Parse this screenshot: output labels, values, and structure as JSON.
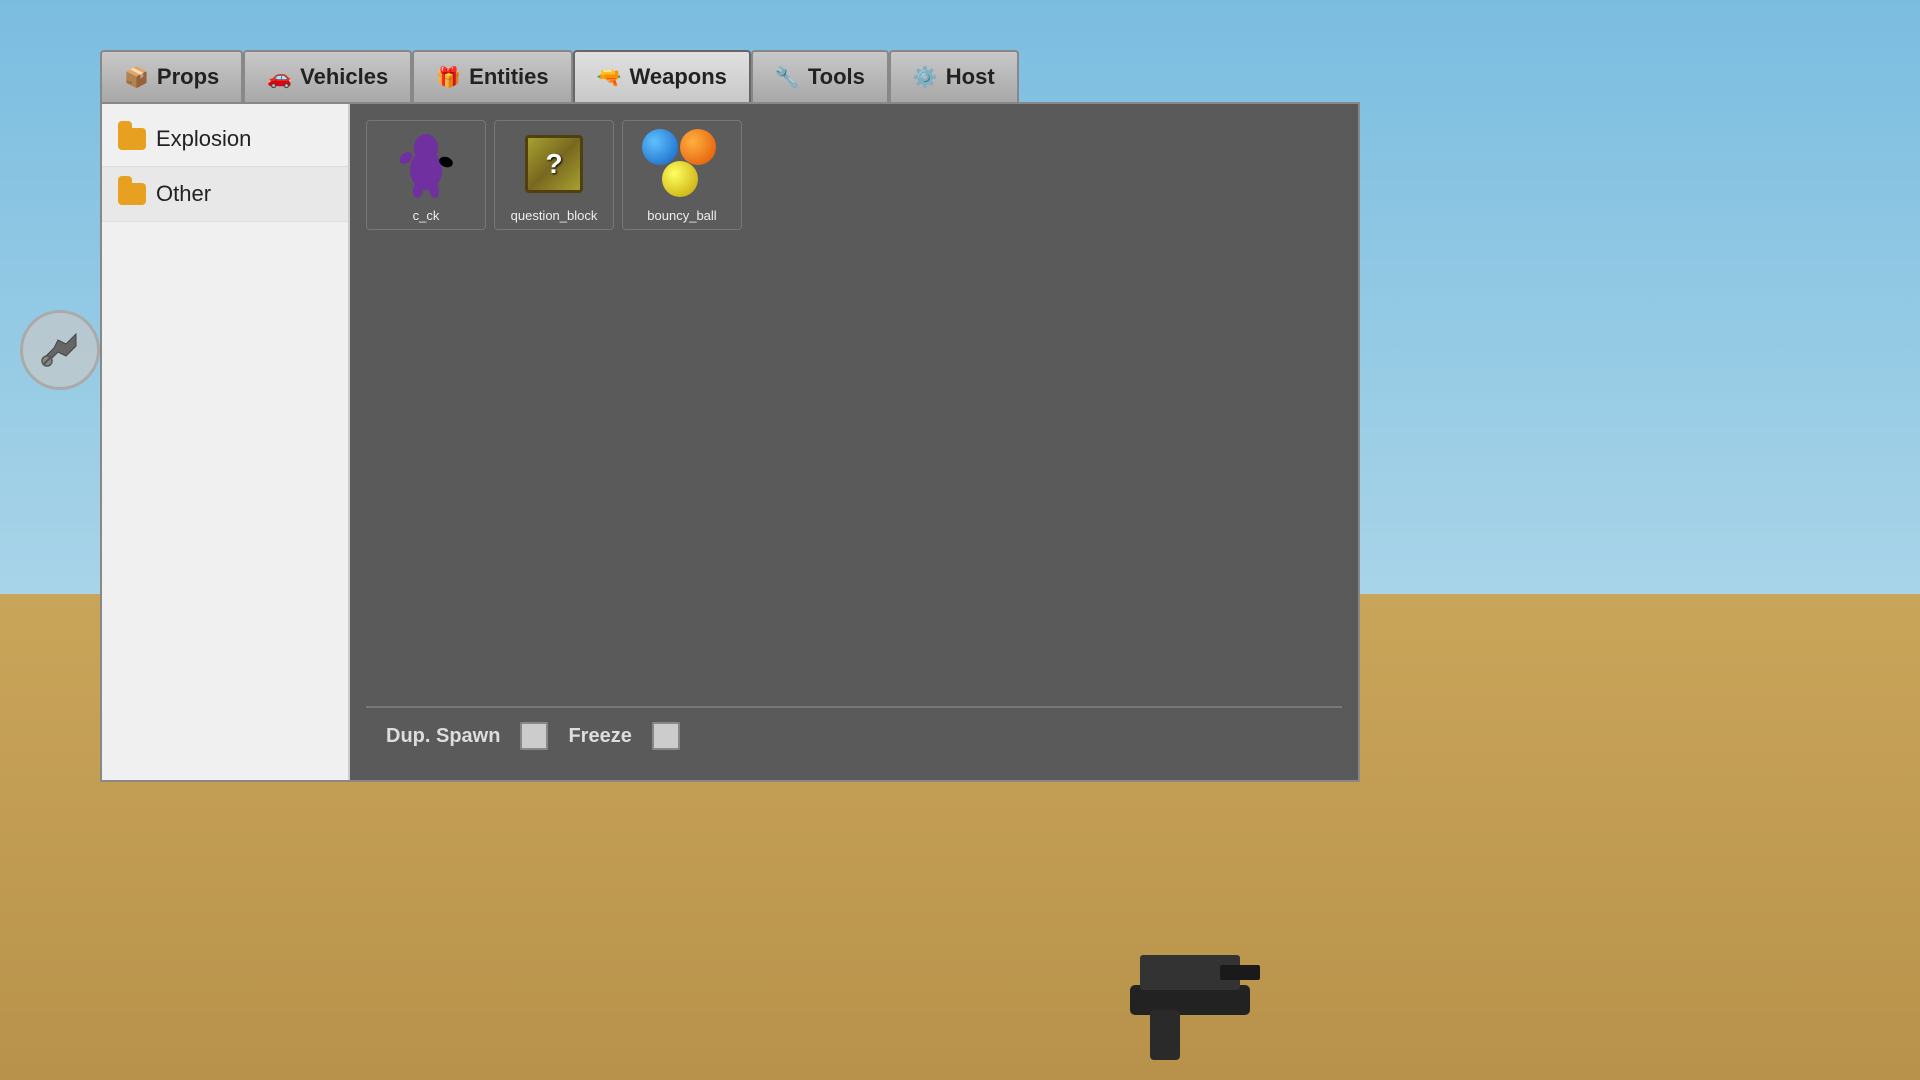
{
  "background": {
    "sky_color": "#7bbde0",
    "ground_color": "#c9a55a"
  },
  "tabs": [
    {
      "id": "props",
      "label": "Props",
      "icon": "📦",
      "active": false
    },
    {
      "id": "vehicles",
      "label": "Vehicles",
      "icon": "🚗",
      "active": false
    },
    {
      "id": "entities",
      "label": "Entities",
      "icon": "🎁",
      "active": false
    },
    {
      "id": "weapons",
      "label": "Weapons",
      "icon": "🔫",
      "active": true
    },
    {
      "id": "tools",
      "label": "Tools",
      "icon": "🔧",
      "active": false
    },
    {
      "id": "host",
      "label": "Host",
      "icon": "⚙️",
      "active": false
    }
  ],
  "sidebar": {
    "items": [
      {
        "id": "explosion",
        "label": "Explosion",
        "active": false
      },
      {
        "id": "other",
        "label": "Other",
        "active": true
      }
    ]
  },
  "items": [
    {
      "id": "c_ck",
      "label": "c_ck",
      "type": "character"
    },
    {
      "id": "question_block",
      "label": "question_block",
      "type": "block"
    },
    {
      "id": "bouncy_ball",
      "label": "bouncy_ball",
      "type": "balls"
    }
  ],
  "bottom_bar": {
    "dup_spawn_label": "Dup. Spawn",
    "freeze_label": "Freeze"
  }
}
